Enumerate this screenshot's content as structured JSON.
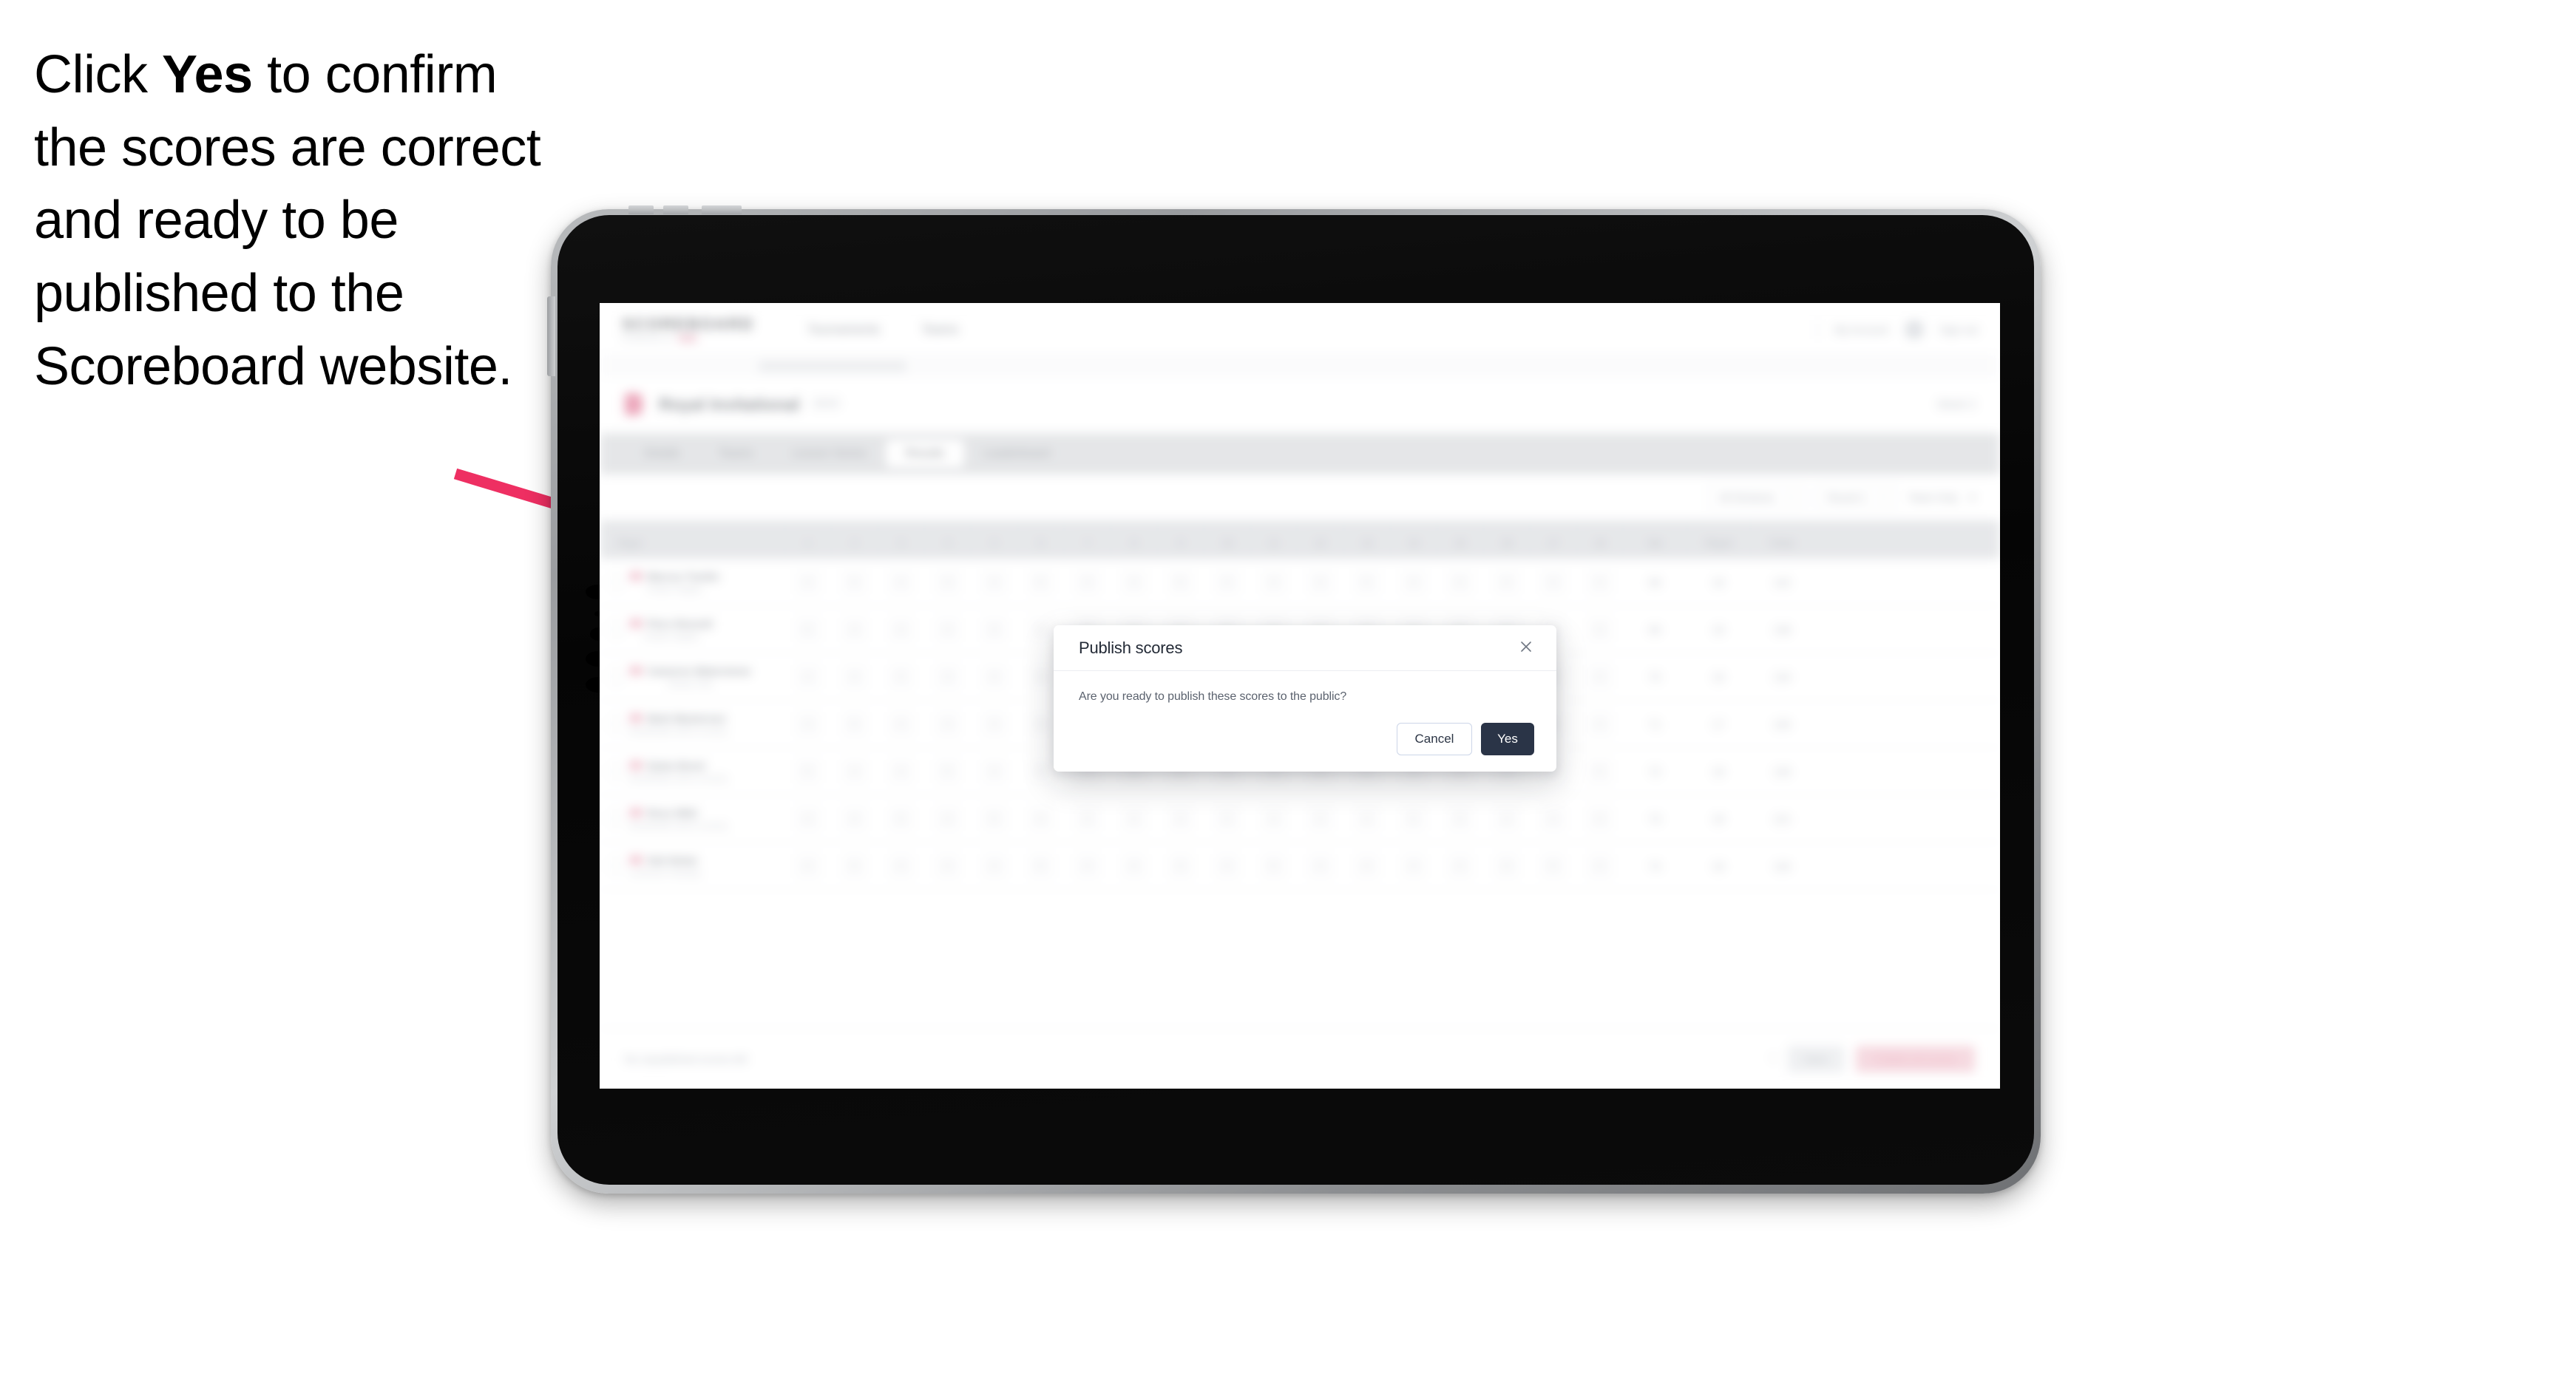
{
  "instruction": {
    "before": "Click ",
    "emphasis": "Yes",
    "after": " to confirm the scores are correct and ready to be published to the Scoreboard website."
  },
  "colors": {
    "arrow": "#ee2f62",
    "modal_primary": "#2a3447",
    "accent_pink": "#f46c94"
  },
  "app": {
    "header": {
      "brand": "SCOREBOARD",
      "brand_sub": "POWERED BY",
      "nav": [
        "Tournaments",
        "Teams"
      ],
      "account": "My Account",
      "user": "Sign out"
    },
    "breadcrumb": "Tournaments / Event",
    "title": {
      "main": "Royal Invitational",
      "sub": "2023",
      "right": "Week 3"
    },
    "tabs": [
      {
        "label": "Details",
        "active": false
      },
      {
        "label": "Teams",
        "active": false
      },
      {
        "label": "Lesson Series",
        "active": false
      },
      {
        "label": "Results",
        "active": true
      },
      {
        "label": "Leaderboard",
        "active": false
      }
    ],
    "filters": {
      "division": "All Divisions",
      "round": "Round 1",
      "team": "Team Only",
      "count": "5"
    },
    "table": {
      "columns_player": "Player",
      "columns_num": [
        "1",
        "2",
        "3",
        "4",
        "5",
        "6",
        "7",
        "8",
        "9",
        "10",
        "11",
        "12",
        "13",
        "14",
        "15",
        "16",
        "17",
        "18"
      ],
      "columns_wide": [
        "Net",
        "Played",
        "Points"
      ],
      "rows": [
        {
          "name": "Marcus Tomlin",
          "club": "Pewter Heights",
          "scores": [
            "4",
            "5",
            "4",
            "3",
            "4",
            "5",
            "4",
            "4",
            "5",
            "4",
            "4",
            "3",
            "5",
            "4",
            "4",
            "4",
            "3",
            "4"
          ],
          "net": "68",
          "played": "18",
          "points": "142"
        },
        {
          "name": "Piers Rennell",
          "club": "Pewter Heights",
          "scores": [
            "5",
            "4",
            "4",
            "4",
            "3",
            "4",
            "5",
            "4",
            "4",
            "5",
            "4",
            "4",
            "3",
            "4",
            "5",
            "4",
            "4",
            "3"
          ],
          "net": "69",
          "played": "18",
          "points": "138"
        },
        {
          "name": "Cameron Waterstone",
          "club": "Rowan Park",
          "scores": [
            "4",
            "4",
            "5",
            "3",
            "4",
            "4",
            "4",
            "5",
            "4",
            "4",
            "5",
            "3",
            "4",
            "4",
            "4",
            "5",
            "4",
            "4"
          ],
          "net": "70",
          "played": "18",
          "points": "134"
        },
        {
          "name": "Mark Masterson",
          "club": "Brookheath Golf & Country",
          "scores": [
            "4",
            "5",
            "4",
            "4",
            "4",
            "3",
            "5",
            "4",
            "4",
            "4",
            "4",
            "5",
            "4",
            "3",
            "4",
            "4",
            "5",
            "4"
          ],
          "net": "71",
          "played": "17",
          "points": "130"
        },
        {
          "name": "Dylan Brent",
          "club": "Brookheath Golf & Country",
          "scores": [
            "5",
            "4",
            "4",
            "5",
            "4",
            "4",
            "4",
            "3",
            "5",
            "4",
            "4",
            "4",
            "5",
            "4",
            "4",
            "3",
            "4",
            "5"
          ],
          "net": "72",
          "played": "18",
          "points": "126"
        },
        {
          "name": "Ross Wild",
          "club": "Brookheath Golf & Country",
          "scores": [
            "4",
            "4",
            "5",
            "4",
            "5",
            "4",
            "3",
            "4",
            "4",
            "5",
            "4",
            "4",
            "4",
            "5",
            "3",
            "4",
            "4",
            "4"
          ],
          "net": "73",
          "played": "18",
          "points": "121"
        },
        {
          "name": "Seb Nolan",
          "club": "Lochmoor Fairways",
          "scores": [
            "4",
            "5",
            "4",
            "4",
            "4",
            "5",
            "4",
            "4",
            "3",
            "4",
            "5",
            "4",
            "4",
            "4",
            "4",
            "3",
            "5",
            "4"
          ],
          "net": "74",
          "played": "18",
          "points": "118"
        }
      ]
    },
    "actionbar": {
      "left": "No unpublished scores left",
      "note": "7",
      "secondary": "Save",
      "primary": "Publish all scores"
    }
  },
  "modal": {
    "title": "Publish scores",
    "body": "Are you ready to publish these scores to the public?",
    "cancel_label": "Cancel",
    "yes_label": "Yes",
    "close_icon": "close-icon"
  }
}
